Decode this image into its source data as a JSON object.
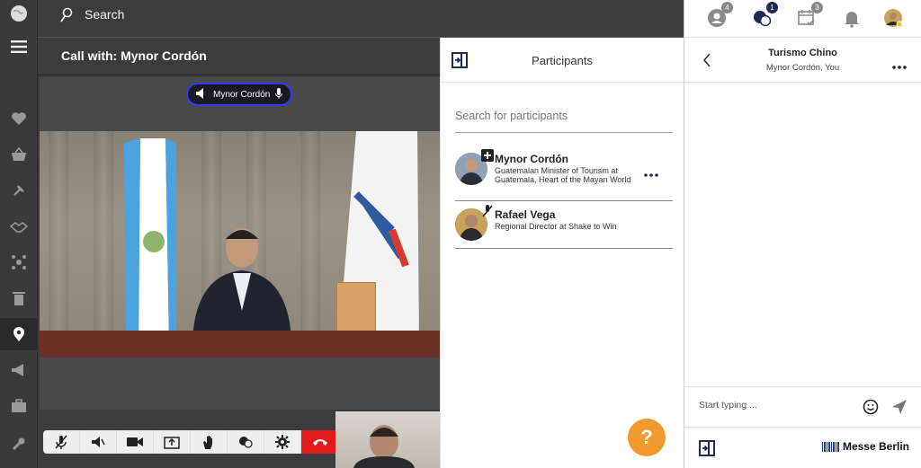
{
  "topbar": {
    "search_label": "Search"
  },
  "call": {
    "title": "Call with: Mynor Cordón",
    "speaker_name": "Mynor Cordón",
    "controls": [
      "mute-microphone",
      "speaker",
      "camera",
      "share-screen",
      "raise-hand",
      "chat",
      "settings",
      "hang-up"
    ]
  },
  "participants": {
    "title": "Participants",
    "search_placeholder": "Search for participants",
    "items": [
      {
        "name": "Mynor Cordón",
        "role": "Guatemalan Minister of Tourism at Guatemala, Heart of the Mayan World"
      },
      {
        "name": "Rafael Vega",
        "role": "Regional Director at Shake to Win"
      }
    ]
  },
  "notifications": {
    "contacts_count": "4",
    "chat_count": "1",
    "calendar_count": "3"
  },
  "chat": {
    "title": "Turismo Chino",
    "subtitle": "Mynor Cordón, You",
    "compose_placeholder": "Start typing ...",
    "brand": "Messe Berlin"
  },
  "help": {
    "label": "?"
  },
  "colors": {
    "accent": "#2d3cff",
    "hangup": "#e21b1b",
    "help": "#f29a2e",
    "navy": "#1f2b57"
  }
}
